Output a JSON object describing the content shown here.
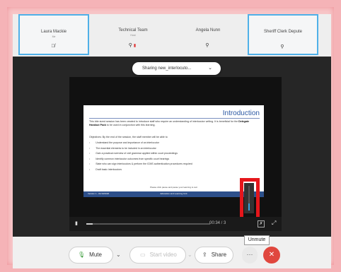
{
  "participants": [
    {
      "name": "Laura Mackie",
      "sub": "Me",
      "active": true
    },
    {
      "name": "Technical Team",
      "sub": "Host"
    },
    {
      "name": "Angela Nunn"
    },
    {
      "name": "Sheriff Clerk Depute",
      "active": true
    }
  ],
  "share_pill": {
    "label": "Sharing new_interlocuto...",
    "chevron_icon": "chevron-down-icon"
  },
  "slide": {
    "title": "Introduction",
    "intro_prefix": "This bite sized session has been created to introduce staff who require an understanding of interlocutor writing.  It is beneficial for the",
    "intro_bold": "Delegate Handout Pack",
    "intro_suffix": "to be used in conjunction with this learning.",
    "objectives": "Objectives:  By the end of the session, the staff member will be able to",
    "bullets": [
      "Understand the purpose and importance of an interlocutor",
      "The essential elements to be included in an interlocutor",
      "Gain a practical overview of civil grammar applied within court proceedings",
      "Identify common interlocutor outcomes from specific court hearings",
      "State who can sign interlocutors & perform the ICMS authentication procedures required",
      "Draft basic interlocutors"
    ],
    "footnote": "Please click pause and pause your learning to suit",
    "footer_left": "Version 1 - 01/10/2020",
    "footer_center": "Education and Learning Unit"
  },
  "player": {
    "time": "00:34 / 3",
    "progress": 0.05,
    "volume": 0.3,
    "play_icon": "play-icon",
    "mute_icon": "mute-icon",
    "fullscreen_icon": "fullscreen-icon"
  },
  "tooltip": "Unmute",
  "toolbar": {
    "mute_label": "Mute",
    "video_label": "Start video",
    "share_label": "Share",
    "more_label": "···",
    "end_label": "✕"
  },
  "colors": {
    "accent": "#4fb0e8",
    "end_call": "#e0473e",
    "highlight": "#e5161b"
  }
}
